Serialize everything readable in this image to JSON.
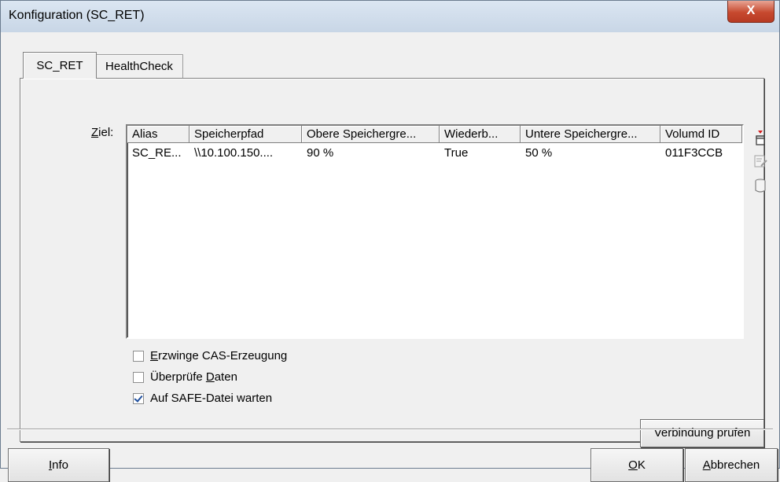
{
  "window": {
    "title": "Konfiguration (SC_RET)",
    "close_label": "X"
  },
  "tabs": [
    {
      "label": "SC_RET",
      "active": true
    },
    {
      "label": "HealthCheck",
      "active": false
    }
  ],
  "ziel": {
    "label": "Ziel:",
    "columns": [
      "Alias",
      "Speicherpfad",
      "Obere Speichergre...",
      "Wiederb...",
      "Untere Speichergre...",
      "Volumd ID"
    ],
    "rows": [
      [
        "SC_RE...",
        "\\\\10.100.150....",
        "90 %",
        "True",
        "50 %",
        "011F3CCB"
      ]
    ]
  },
  "side_icons": [
    "add-icon",
    "edit-icon",
    "delete-icon"
  ],
  "options": [
    {
      "label": "Erzwinge CAS-Erzeugung",
      "checked": false
    },
    {
      "label": "Überprüfe Daten",
      "checked": false
    },
    {
      "label": "Auf SAFE-Datei warten",
      "checked": true
    }
  ],
  "buttons": {
    "verbindung": "Verbindung prüfen",
    "info": "Info",
    "ok": "OK",
    "cancel": "Abbrechen"
  }
}
